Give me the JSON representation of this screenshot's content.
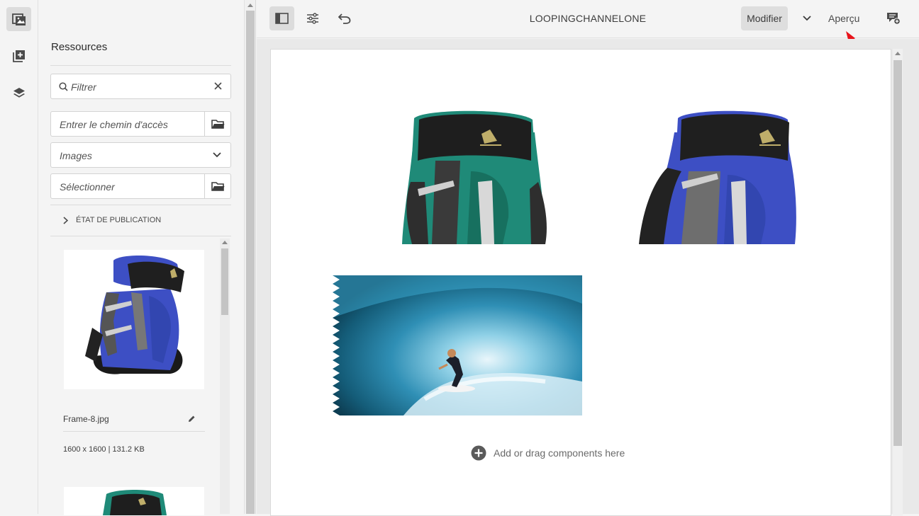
{
  "rail": {
    "items": [
      {
        "icon": "assets-icon",
        "active": true
      },
      {
        "icon": "components-icon",
        "active": false
      },
      {
        "icon": "layers-icon",
        "active": false
      }
    ]
  },
  "panel": {
    "title": "Ressources",
    "filter_placeholder": "Filtrer",
    "path_placeholder": "Entrer le chemin d'accès",
    "type_value": "Images",
    "select_placeholder": "Sélectionner",
    "publication_label": "ÉTAT DE PUBLICATION",
    "asset": {
      "name": "Frame-8.jpg",
      "meta": "1600 x 1600 | 131.2 KB"
    }
  },
  "toolbar": {
    "title": "LOOPINGCHANNELONE",
    "mode_label": "Modifier",
    "preview_label": "Aperçu"
  },
  "canvas": {
    "add_components_label": "Add or drag components here"
  },
  "colors": {
    "backpack_green": "#1f8a78",
    "backpack_blue": "#3d4fc4",
    "annotation_arrow": "#e8141b"
  }
}
